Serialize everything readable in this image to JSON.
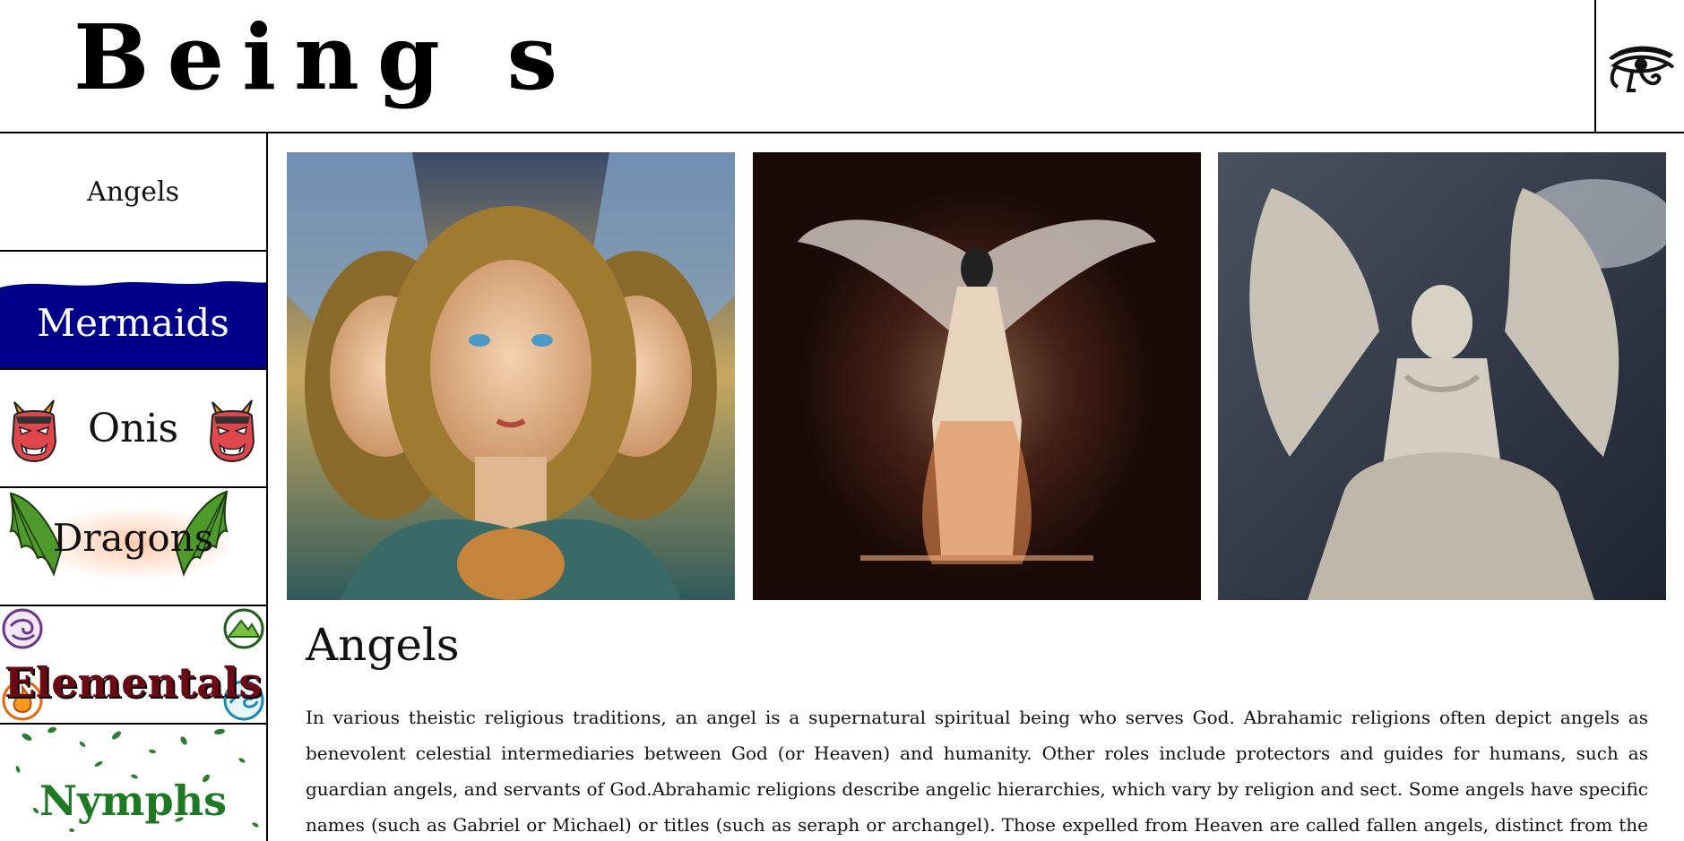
{
  "header": {
    "title": "Being s",
    "logo_icon": "eye-of-horus-icon"
  },
  "sidebar": {
    "items": [
      {
        "label": "Angels",
        "icon": ""
      },
      {
        "label": "Mermaids",
        "icon": "wave-icon",
        "color": "#00008b"
      },
      {
        "label": "Onis",
        "icon": "oni-mask-icon"
      },
      {
        "label": "Dragons",
        "icon": "dragon-wing-icon"
      },
      {
        "label": "Elementals",
        "icon": "element-icons"
      },
      {
        "label": "Nymphs",
        "icon": "leaf-icon"
      }
    ]
  },
  "main": {
    "gallery": [
      {
        "icon": "angels-painting-image"
      },
      {
        "icon": "dark-angel-image"
      },
      {
        "icon": "angel-statue-image"
      }
    ],
    "section_title": "Angels",
    "section_body": "In various theistic religious traditions, an angel is a supernatural spiritual being who serves God. Abrahamic religions often depict angels as benevolent celestial intermediaries between God (or Heaven) and humanity. Other roles include protectors and guides for humans, such as guardian angels, and servants of God.Abrahamic religions describe angelic hierarchies, which vary by religion and sect. Some angels have specific names (such as Gabriel or Michael) or titles (such as seraph or archangel). Those expelled from Heaven are called fallen angels, distinct from the heavenly host."
  },
  "colors": {
    "mermaids_bg": "#00008b",
    "elementals_text": "#6b0a14",
    "nymphs_text": "#1e7a22",
    "border": "#000000"
  }
}
